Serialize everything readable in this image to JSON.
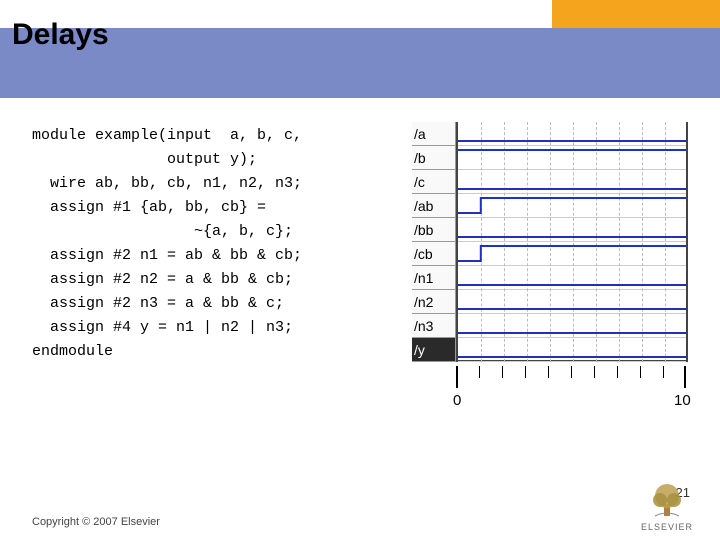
{
  "title": "Delays",
  "code_lines": [
    "module example(input  a, b, c,",
    "               output y);",
    "  wire ab, bb, cb, n1, n2, n3;",
    "  assign #1 {ab, bb, cb} =",
    "                  ~{a, b, c};",
    "  assign #2 n1 = ab & bb & cb;",
    "  assign #2 n2 = a & bb & cb;",
    "  assign #2 n3 = a & bb & c;",
    "  assign #4 y = n1 | n2 | n3;",
    "endmodule"
  ],
  "signals": [
    "/a",
    "/b",
    "/c",
    "/ab",
    "/bb",
    "/cb",
    "/n1",
    "/n2",
    "/n3",
    "/y"
  ],
  "selected_signal_index": 9,
  "axis": {
    "min": 0,
    "max": 10,
    "labels": [
      "0",
      "10"
    ]
  },
  "footer": "Copyright © 2007 Elsevier",
  "page": "21",
  "publisher": "ELSEVIER",
  "chart_data": {
    "type": "timing",
    "time_range": [
      0,
      10
    ],
    "traces": [
      {
        "name": "/a",
        "points": [
          [
            0,
            0
          ],
          [
            10,
            0
          ]
        ]
      },
      {
        "name": "/b",
        "points": [
          [
            0,
            1
          ],
          [
            10,
            1
          ]
        ]
      },
      {
        "name": "/c",
        "points": [
          [
            0,
            0
          ],
          [
            10,
            0
          ]
        ]
      },
      {
        "name": "/ab",
        "points": [
          [
            0,
            0
          ],
          [
            1,
            0
          ],
          [
            1,
            1
          ],
          [
            10,
            1
          ]
        ]
      },
      {
        "name": "/bb",
        "points": [
          [
            0,
            0
          ],
          [
            1,
            0
          ],
          [
            1,
            0
          ],
          [
            10,
            0
          ]
        ]
      },
      {
        "name": "/cb",
        "points": [
          [
            0,
            0
          ],
          [
            1,
            0
          ],
          [
            1,
            1
          ],
          [
            10,
            1
          ]
        ]
      },
      {
        "name": "/n1",
        "points": [
          [
            0,
            0
          ],
          [
            3,
            0
          ],
          [
            3,
            0
          ],
          [
            10,
            0
          ]
        ]
      },
      {
        "name": "/n2",
        "points": [
          [
            0,
            0
          ],
          [
            3,
            0
          ],
          [
            3,
            0
          ],
          [
            10,
            0
          ]
        ]
      },
      {
        "name": "/n3",
        "points": [
          [
            0,
            0
          ],
          [
            3,
            0
          ],
          [
            3,
            0
          ],
          [
            10,
            0
          ]
        ]
      },
      {
        "name": "/y",
        "points": [
          [
            0,
            0
          ],
          [
            7,
            0
          ],
          [
            7,
            0
          ],
          [
            10,
            0
          ]
        ]
      }
    ]
  }
}
